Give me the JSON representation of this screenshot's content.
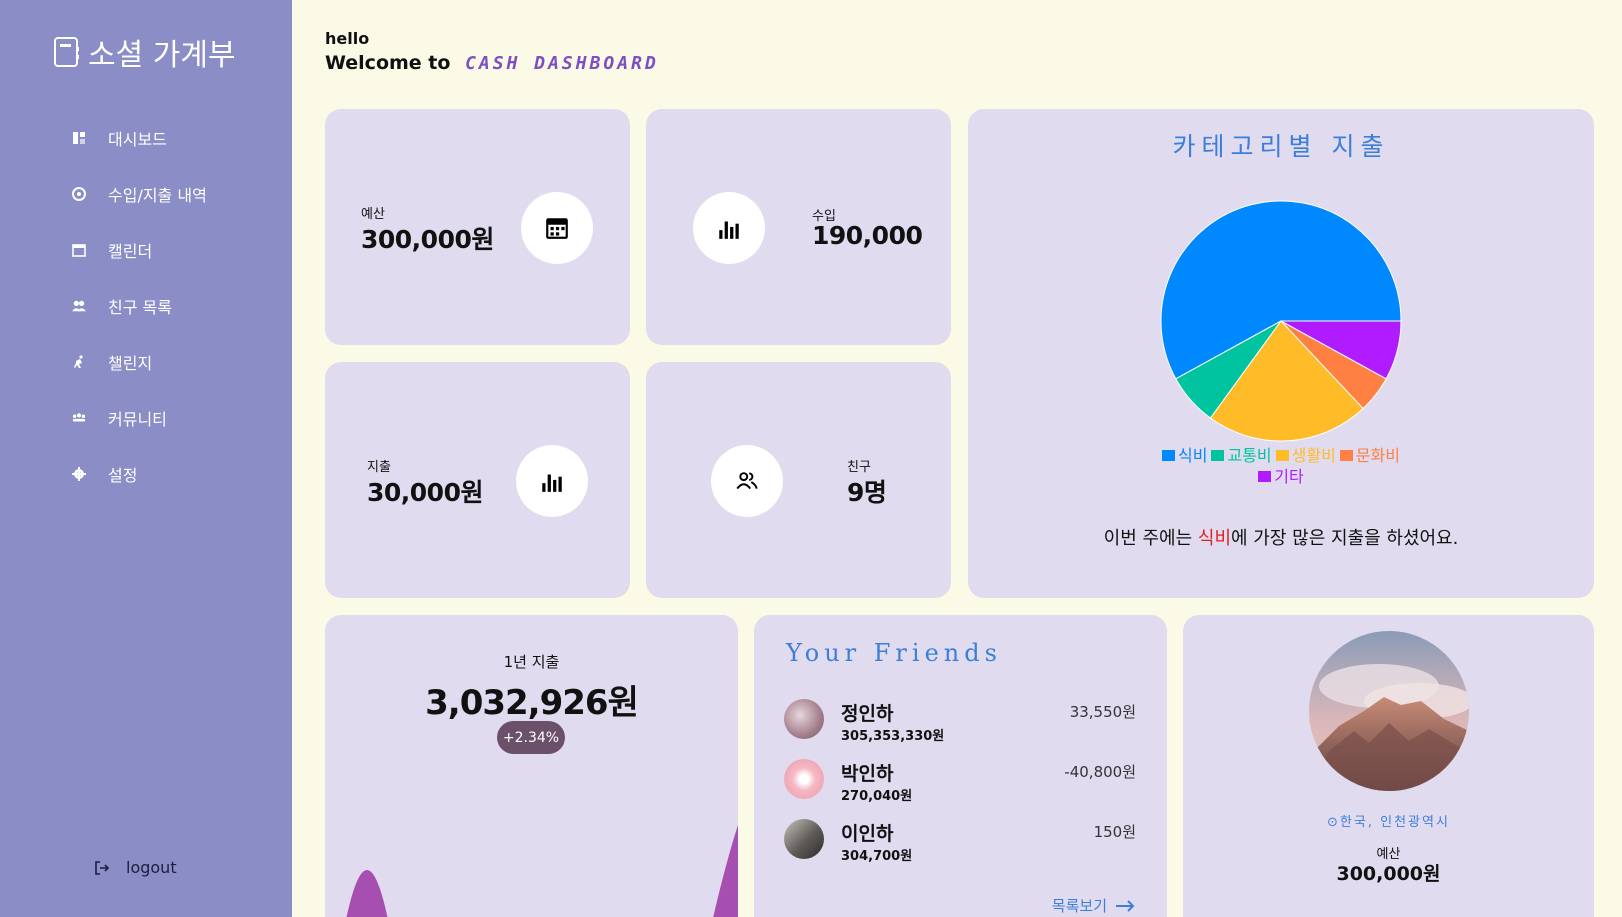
{
  "sidebar": {
    "brand": "소셜 가계부",
    "items": [
      {
        "label": "대시보드",
        "icon": "dashboard-icon"
      },
      {
        "label": "수입/지출 내역",
        "icon": "history-icon"
      },
      {
        "label": "캘린더",
        "icon": "calendar-icon"
      },
      {
        "label": "친구 목록",
        "icon": "friends-icon"
      },
      {
        "label": "챌린지",
        "icon": "running-icon"
      },
      {
        "label": "커뮤니티",
        "icon": "community-icon"
      },
      {
        "label": "설정",
        "icon": "gear-icon"
      }
    ],
    "logout": "logout"
  },
  "header": {
    "hello": "hello",
    "welcome": "Welcome to",
    "brand": "CASH DASHBOARD"
  },
  "stats": {
    "budget": {
      "label": "예산",
      "value": "300,000원"
    },
    "income": {
      "label": "수입",
      "value": "190,000"
    },
    "expense": {
      "label": "지출",
      "value": "30,000원"
    },
    "friends": {
      "label": "친구",
      "value": "9명"
    }
  },
  "category_chart": {
    "title": "카테고리별 지출",
    "summary_pre": "이번 주에는 ",
    "summary_highlight": "식비",
    "summary_post": "에 가장 많은 지출을 하셨어요."
  },
  "chart_data": {
    "type": "pie",
    "title": "카테고리별 지출",
    "categories": [
      "식비",
      "교통비",
      "생활비",
      "문화비",
      "기타"
    ],
    "values": [
      58,
      7,
      22,
      5,
      8
    ],
    "colors": [
      "#0088fe",
      "#00c49f",
      "#ffbb28",
      "#ff8042",
      "#b01cff"
    ],
    "legend": "bottom"
  },
  "yearly": {
    "label": "1년 지출",
    "value": "3,032,926원",
    "change": "+2.34%"
  },
  "friends_card": {
    "title": "Your Friends",
    "items": [
      {
        "name": "정인하",
        "total": "305,353,330원",
        "amount": "33,550원"
      },
      {
        "name": "박인하",
        "total": "270,040원",
        "amount": "-40,800원"
      },
      {
        "name": "이인하",
        "total": "304,700원",
        "amount": "150원"
      }
    ],
    "more": "목록보기"
  },
  "profile": {
    "location": "한국, 인천광역시",
    "label": "예산",
    "value": "300,000원"
  },
  "colors": {
    "sidebar": "#8a8dc6",
    "card": "#e0dbef",
    "background": "#fafae6",
    "accent": "#3c7fd8"
  }
}
